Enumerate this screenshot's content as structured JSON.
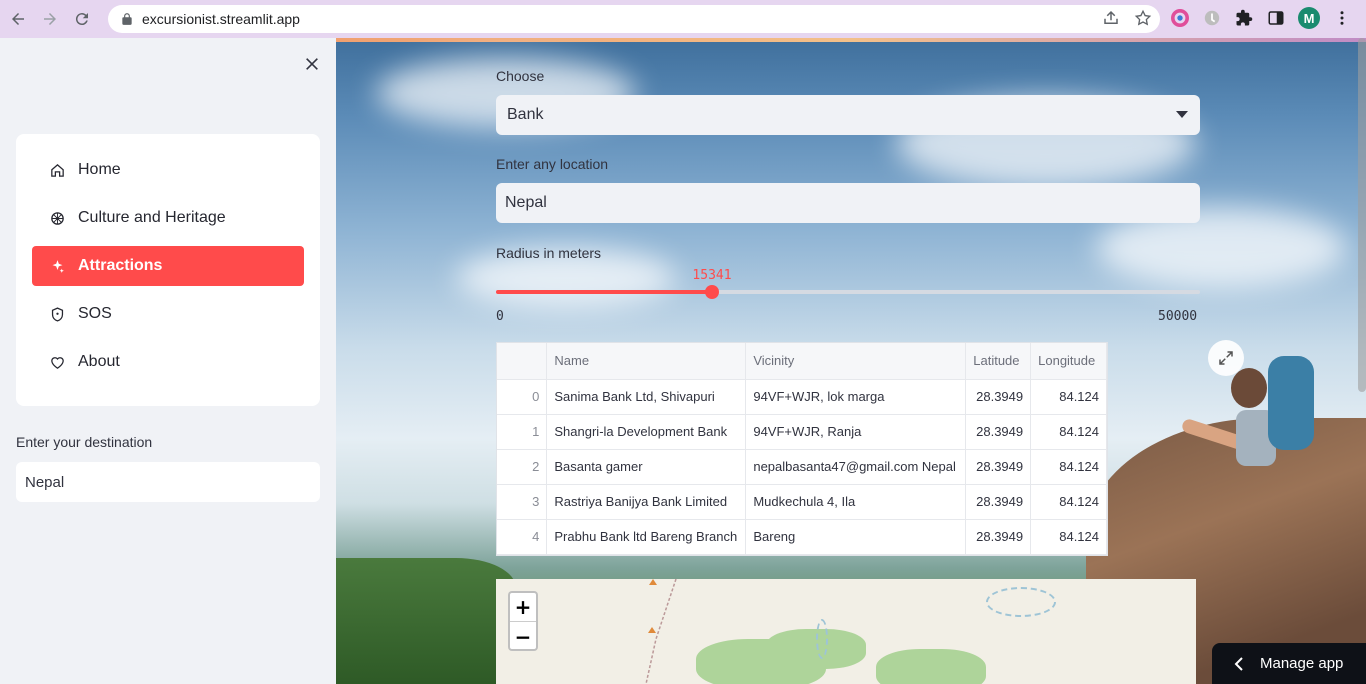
{
  "browser": {
    "url": "excursionist.streamlit.app",
    "profile_initial": "M"
  },
  "sidebar": {
    "menu": [
      {
        "label": "Home",
        "icon": "house-icon"
      },
      {
        "label": "Culture and Heritage",
        "icon": "dharma-wheel-icon"
      },
      {
        "label": "Attractions",
        "icon": "sparkles-icon",
        "active": true
      },
      {
        "label": "SOS",
        "icon": "shield-icon"
      },
      {
        "label": "About",
        "icon": "heart-icon"
      }
    ],
    "destination_label": "Enter your destination",
    "destination_value": "Nepal"
  },
  "main": {
    "choose_label": "Choose",
    "choose_value": "Bank",
    "location_label": "Enter any location",
    "location_value": "Nepal",
    "radius_label": "Radius in meters",
    "slider": {
      "min": 0,
      "max": 50000,
      "value": 15341,
      "min_label": "0",
      "max_label": "50000",
      "value_label": "15341"
    },
    "table": {
      "columns": [
        "",
        "Name",
        "Vicinity",
        "Latitude",
        "Longitude"
      ],
      "rows": [
        {
          "idx": "0",
          "name": "Sanima Bank Ltd, Shivapuri",
          "vicinity": "94VF+WJR, lok marga",
          "lat": "28.3949",
          "lng": "84.124"
        },
        {
          "idx": "1",
          "name": "Shangri-la Development Bank",
          "vicinity": "94VF+WJR, Ranja",
          "lat": "28.3949",
          "lng": "84.124"
        },
        {
          "idx": "2",
          "name": "Basanta gamer",
          "vicinity": "nepalbasanta47@gmail.com Nepal",
          "lat": "28.3949",
          "lng": "84.124"
        },
        {
          "idx": "3",
          "name": "Rastriya Banijya Bank Limited",
          "vicinity": "Mudkechula 4, Ila",
          "lat": "28.3949",
          "lng": "84.124"
        },
        {
          "idx": "4",
          "name": "Prabhu Bank ltd Bareng Branch",
          "vicinity": "Bareng",
          "lat": "28.3949",
          "lng": "84.124"
        }
      ]
    },
    "map": {
      "zoom_in": "+",
      "zoom_out": "−"
    },
    "manage_app": "Manage app"
  },
  "colors": {
    "accent": "#ff4b4b",
    "sidebar_bg": "#f0f2f6"
  }
}
